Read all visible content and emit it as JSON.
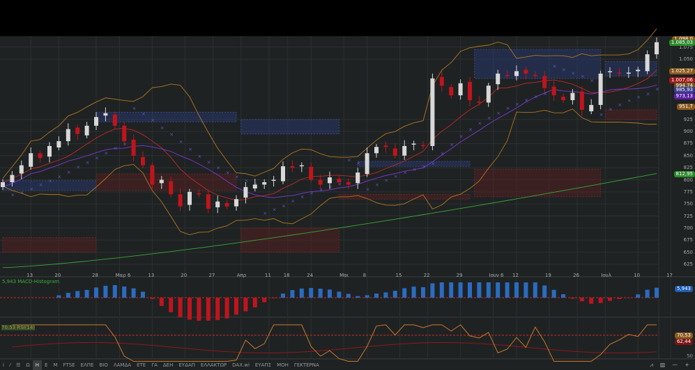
{
  "chart_data": {
    "type": "candlestick",
    "ylim": [
      612,
      1100
    ],
    "y_ticks": [
      "1.075",
      "1.050",
      "925",
      "900",
      "875",
      "850",
      "825",
      "800",
      "775",
      "750",
      "725",
      "700",
      "675",
      "650",
      "625"
    ],
    "y_tick_values": [
      1075,
      1050,
      925,
      900,
      875,
      850,
      825,
      800,
      775,
      750,
      725,
      700,
      675,
      650,
      625
    ],
    "x_ticks": [
      "13",
      "20",
      "28",
      "Μαρ 6",
      "13",
      "20",
      "27",
      "Απρ",
      "11",
      "18",
      "24",
      "Μαι",
      "8",
      "15",
      "22",
      "29",
      "Ιουν 6",
      "12",
      "19",
      "26",
      "Ιουλ",
      "10",
      "17"
    ],
    "x_tick_index": [
      3,
      6,
      10,
      12.5,
      16,
      19.5,
      22.5,
      25.5,
      28.5,
      30.5,
      33,
      36.5,
      39,
      42.5,
      45.5,
      49,
      52.5,
      55,
      58.5,
      61.5,
      64.5,
      68,
      71.5
    ],
    "close": [
      795,
      810,
      830,
      855,
      845,
      870,
      880,
      905,
      895,
      912,
      930,
      938,
      912,
      880,
      850,
      830,
      790,
      800,
      770,
      745,
      775,
      770,
      740,
      755,
      745,
      760,
      785,
      790,
      795,
      800,
      828,
      825,
      830,
      800,
      790,
      805,
      795,
      790,
      815,
      855,
      868,
      868,
      850,
      870,
      875,
      870,
      1010,
      995,
      975,
      1000,
      965,
      960,
      995,
      1020,
      1015,
      1025,
      1020,
      1015,
      990,
      975,
      965,
      980,
      945,
      955,
      1020,
      1025,
      1020,
      1022,
      1028,
      1060,
      1085
    ],
    "zones": [
      {
        "type": "supply",
        "from": 10,
        "to": 25,
        "low": 920,
        "high": 940
      },
      {
        "type": "supply",
        "from": 25.5,
        "to": 36,
        "low": 895,
        "high": 925
      },
      {
        "type": "supply",
        "from": 50.5,
        "to": 64,
        "low": 1010,
        "high": 1070
      },
      {
        "type": "supply",
        "from": 64.5,
        "to": 70,
        "low": 1015,
        "high": 1045
      },
      {
        "type": "supply",
        "from": 0,
        "to": 10,
        "low": 778,
        "high": 798
      },
      {
        "type": "supply",
        "from": 38,
        "to": 50,
        "low": 828,
        "high": 838
      },
      {
        "type": "demand",
        "from": 10,
        "to": 25,
        "low": 778,
        "high": 812
      },
      {
        "type": "demand",
        "from": 0,
        "to": 10,
        "low": 650,
        "high": 680
      },
      {
        "type": "demand",
        "from": 25.5,
        "to": 36,
        "low": 650,
        "high": 700
      },
      {
        "type": "demand",
        "from": 36,
        "to": 50,
        "low": 760,
        "high": 770
      },
      {
        "type": "demand",
        "from": 50.5,
        "to": 64,
        "low": 765,
        "high": 822
      },
      {
        "type": "demand",
        "from": 64.5,
        "to": 70,
        "low": 925,
        "high": 945
      }
    ],
    "sma_long_start": 618,
    "sma_long_end": 812.95,
    "price_tags": [
      {
        "text": "1.098,0",
        "value": 1098,
        "color": "#8a5a1e"
      },
      {
        "text": "1.085,03",
        "value": 1085,
        "color": "#2b8a2b"
      },
      {
        "text": "1.025,27",
        "value": 1025.27,
        "color": "#8a5a1e"
      },
      {
        "text": "1.007,06",
        "value": 1007.06,
        "color": "#a01818"
      },
      {
        "text": "994,74",
        "value": 994.74,
        "color": "#6b5520"
      },
      {
        "text": "985,93",
        "value": 985.93,
        "color": "#3a3a8a"
      },
      {
        "text": "973,13",
        "value": 973.13,
        "color": "#5a1ea0"
      },
      {
        "text": "951,7",
        "value": 951.7,
        "color": "#8a5a1e"
      },
      {
        "text": "812,95",
        "value": 812.95,
        "color": "#2b8a2b"
      }
    ]
  },
  "macd": {
    "label": "5,943 MACD-Histogram",
    "tag": "5,943"
  },
  "rsi": {
    "label": "70,53 RSI(14)",
    "tag": "70,53",
    "tag2": "62,44",
    "level50": "50"
  },
  "toolbar": {
    "items": [
      "i",
      "⁄",
      "☰",
      "Ω",
      "H",
      "E",
      "M",
      "FTSE",
      "ΕΛΠΕ",
      "ΒΙΟ",
      "ΛΑΜΔΑ",
      "ΕΤΕ",
      "ΓΑ",
      "ΔΕΗ",
      "ΕΥΔΑΠ",
      "ΕΛΛΑΚΤΩΡ",
      "DAX.wi",
      "ΕΥΑΠΣ",
      "ΜΟΗ",
      "ΓΕΚΤΕΡΝΑ"
    ],
    "selected": "H"
  },
  "colors": {
    "up": "#d8d8d8",
    "down": "#c0141c",
    "sar": "#5a5ad0",
    "sma_long": "#3aa83a",
    "band": "#b07820",
    "macd_up": "#2a6cc0"
  }
}
